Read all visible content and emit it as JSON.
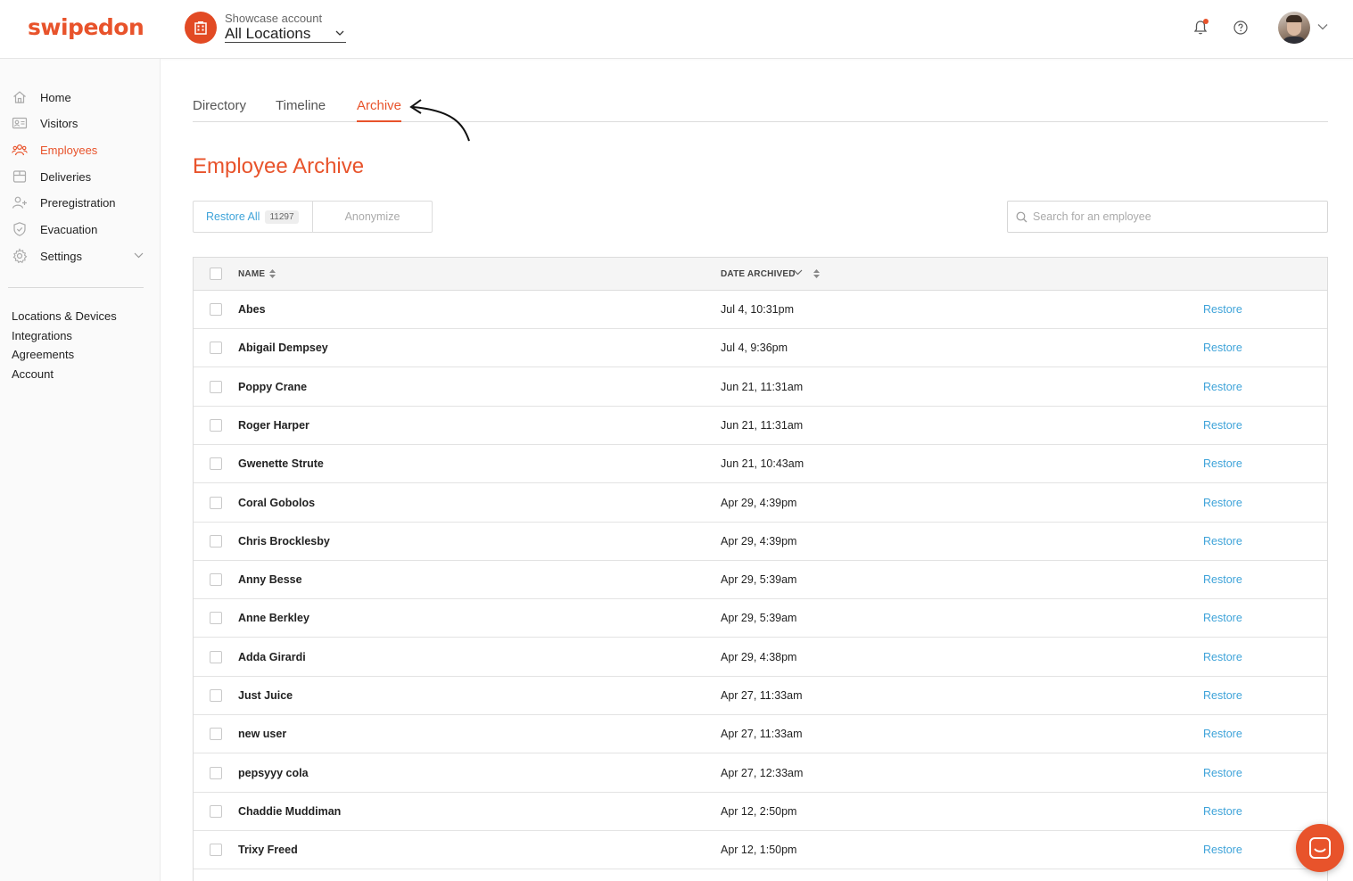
{
  "header": {
    "brand": "swipedon",
    "account_label": "Showcase account",
    "location_selected": "All Locations"
  },
  "sidebar": {
    "items": [
      {
        "label": "Home",
        "icon": "home-icon"
      },
      {
        "label": "Visitors",
        "icon": "id-card-icon"
      },
      {
        "label": "Employees",
        "icon": "people-icon",
        "active": true
      },
      {
        "label": "Deliveries",
        "icon": "package-icon"
      },
      {
        "label": "Preregistration",
        "icon": "person-add-icon"
      },
      {
        "label": "Evacuation",
        "icon": "shield-icon"
      },
      {
        "label": "Settings",
        "icon": "gear-icon"
      }
    ],
    "links": [
      "Locations & Devices",
      "Integrations",
      "Agreements",
      "Account"
    ]
  },
  "tabs": [
    {
      "label": "Directory"
    },
    {
      "label": "Timeline"
    },
    {
      "label": "Archive",
      "active": true
    }
  ],
  "page": {
    "title": "Employee Archive",
    "restore_all_label": "Restore All",
    "restore_all_count": "11297",
    "anonymize_label": "Anonymize",
    "search_placeholder": "Search for an employee"
  },
  "table": {
    "columns": {
      "name": "NAME",
      "date": "DATE ARCHIVED"
    },
    "action_label": "Restore",
    "rows": [
      {
        "name": "Abes",
        "date": "Jul 4, 10:31pm"
      },
      {
        "name": "Abigail Dempsey",
        "date": "Jul 4, 9:36pm"
      },
      {
        "name": "Poppy Crane",
        "date": "Jun 21, 11:31am"
      },
      {
        "name": "Roger Harper",
        "date": "Jun 21, 11:31am"
      },
      {
        "name": "Gwenette Strute",
        "date": "Jun 21, 10:43am"
      },
      {
        "name": "Coral Gobolos",
        "date": "Apr 29, 4:39pm"
      },
      {
        "name": "Chris Brocklesby",
        "date": "Apr 29, 4:39pm"
      },
      {
        "name": "Anny Besse",
        "date": "Apr 29, 5:39am"
      },
      {
        "name": "Anne Berkley",
        "date": "Apr 29, 5:39am"
      },
      {
        "name": "Adda Girardi",
        "date": "Apr 29, 4:38pm"
      },
      {
        "name": "Just Juice",
        "date": "Apr 27, 11:33am"
      },
      {
        "name": "new user",
        "date": "Apr 27, 11:33am"
      },
      {
        "name": "pepsyyy cola",
        "date": "Apr 27, 12:33am"
      },
      {
        "name": "Chaddie Muddiman",
        "date": "Apr 12, 2:50pm"
      },
      {
        "name": "Trixy Freed",
        "date": "Apr 12, 1:50pm"
      }
    ]
  },
  "colors": {
    "accent": "#e8532b",
    "link": "#3ea3d9"
  }
}
